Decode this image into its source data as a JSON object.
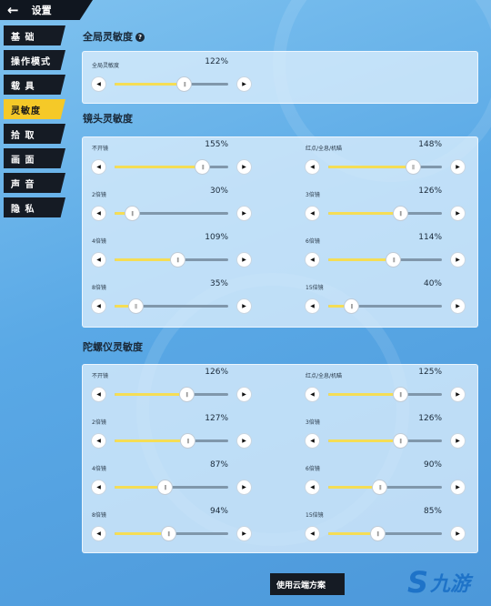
{
  "header": {
    "title": "设置"
  },
  "sidebar": {
    "items": [
      {
        "label": "基 础",
        "active": false
      },
      {
        "label": "操作模式",
        "active": false
      },
      {
        "label": "载 具",
        "active": false
      },
      {
        "label": "灵敏度",
        "active": true
      },
      {
        "label": "拾 取",
        "active": false
      },
      {
        "label": "画 面",
        "active": false
      },
      {
        "label": "声 音",
        "active": false
      },
      {
        "label": "隐 私",
        "active": false
      }
    ]
  },
  "sections": {
    "global": {
      "title": "全局灵敏度",
      "sliders": [
        {
          "label": "全局灵敏度",
          "value": "122%",
          "fraction": 0.61
        }
      ]
    },
    "camera": {
      "title": "镜头灵敏度",
      "sliders": [
        {
          "label": "不开镜",
          "value": "155%",
          "fraction": 0.77
        },
        {
          "label": "红点/全息/机瞄",
          "value": "148%",
          "fraction": 0.74
        },
        {
          "label": "2倍镜",
          "value": "30%",
          "fraction": 0.15
        },
        {
          "label": "3倍镜",
          "value": "126%",
          "fraction": 0.63
        },
        {
          "label": "4倍镜",
          "value": "109%",
          "fraction": 0.55
        },
        {
          "label": "6倍镜",
          "value": "114%",
          "fraction": 0.57
        },
        {
          "label": "8倍镜",
          "value": "35%",
          "fraction": 0.18
        },
        {
          "label": "15倍镜",
          "value": "40%",
          "fraction": 0.2
        }
      ]
    },
    "gyro": {
      "title": "陀螺仪灵敏度",
      "sliders": [
        {
          "label": "不开镜",
          "value": "126%",
          "fraction": 0.63
        },
        {
          "label": "红点/全息/机瞄",
          "value": "125%",
          "fraction": 0.63
        },
        {
          "label": "2倍镜",
          "value": "127%",
          "fraction": 0.64
        },
        {
          "label": "3倍镜",
          "value": "126%",
          "fraction": 0.63
        },
        {
          "label": "4倍镜",
          "value": "87%",
          "fraction": 0.44
        },
        {
          "label": "6倍镜",
          "value": "90%",
          "fraction": 0.45
        },
        {
          "label": "8倍镜",
          "value": "94%",
          "fraction": 0.47
        },
        {
          "label": "15倍镜",
          "value": "85%",
          "fraction": 0.43
        }
      ]
    }
  },
  "footer": {
    "cloud_button": "使用云端方案"
  },
  "watermark": {
    "text": "九游"
  },
  "icons": {
    "back": "arrow-left-icon",
    "help": "question-circle-icon",
    "minus": "triangle-left-icon",
    "plus": "triangle-right-icon"
  },
  "colors": {
    "accent": "#f5c928",
    "fill": "#f5dd55",
    "track": "#8097ab",
    "nav_bg": "#151b24"
  }
}
